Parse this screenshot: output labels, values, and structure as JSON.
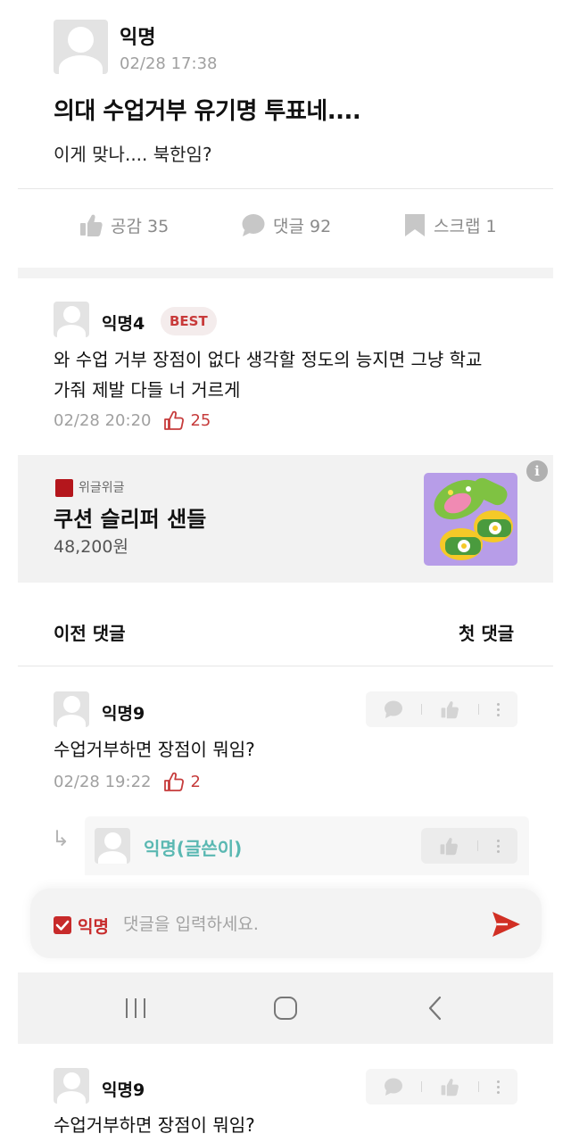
{
  "post": {
    "author": "익명",
    "time": "02/28 17:38",
    "title": "의대 수업거부 유기명 투표네....",
    "body": "이게 맞나.... 북한임?",
    "actions": {
      "like_label": "공감 35",
      "comment_label": "댓글 92",
      "scrap_label": "스크랩 1"
    }
  },
  "best_comment": {
    "author": "익명4",
    "badge": "BEST",
    "text_line1": "와 수업 거부 장점이 없다 생각할 정도의 능지면 그냥 학교",
    "text_line2": "가줘 제발 다들 너 거르게",
    "time": "02/28 20:20",
    "likes": "25"
  },
  "ad": {
    "brand": "위글위글",
    "title": "쿠션 슬리퍼 샌들",
    "price": "48,200원",
    "info_icon": "i"
  },
  "comment_nav": {
    "prev": "이전 댓글",
    "first": "첫 댓글"
  },
  "comments": [
    {
      "author": "익명9",
      "text": "수업거부하면 장점이 뭐임?",
      "time": "02/28 19:22",
      "likes": "2"
    }
  ],
  "reply": {
    "arrow": "↳",
    "author": "익명(글쓴이)"
  },
  "input_bar": {
    "anon_label": "익명",
    "placeholder": "댓글을 입력하세요."
  },
  "repeated_comment": {
    "author": "익명9",
    "text": "수업거부하면 장점이 뭐임?"
  },
  "colors": {
    "accent_red": "#c72a2a",
    "author_teal": "#5ab8b2",
    "muted_gray": "#a0a0a0"
  }
}
